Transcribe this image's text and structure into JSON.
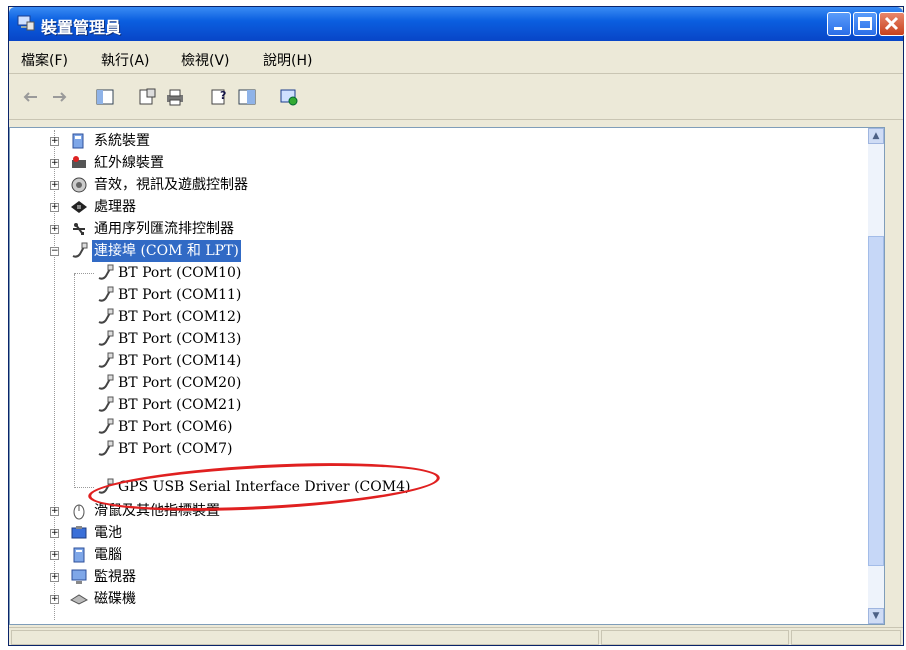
{
  "window": {
    "title": "裝置管理員"
  },
  "menu": {
    "file": "檔案(F)",
    "action": "執行(A)",
    "view": "檢視(V)",
    "help": "說明(H)"
  },
  "toolbar": {
    "icons": [
      "back-arrow-icon",
      "forward-arrow-icon",
      "console-tree-icon",
      "properties-icon",
      "print-icon",
      "help-icon",
      "view-icon",
      "scan-hardware-icon"
    ]
  },
  "tree": {
    "categories": [
      {
        "label": "系統裝置",
        "expanded": false
      },
      {
        "label": "紅外線裝置",
        "expanded": false
      },
      {
        "label": "音效，視訊及遊戲控制器",
        "expanded": false
      },
      {
        "label": "處理器",
        "expanded": false
      },
      {
        "label": "通用序列匯流排控制器",
        "expanded": false
      },
      {
        "label": "連接埠 (COM 和 LPT)",
        "expanded": true,
        "selected": true
      }
    ],
    "ports": [
      "BT Port (COM10)",
      "BT Port (COM11)",
      "BT Port (COM12)",
      "BT Port (COM13)",
      "BT Port (COM14)",
      "BT Port (COM20)",
      "BT Port (COM21)",
      "BT Port (COM6)",
      "BT Port (COM7)",
      "GPS USB Serial Interface Driver (COM4)"
    ],
    "after": [
      {
        "label": "滑鼠及其他指標裝置",
        "expanded": false
      },
      {
        "label": "電池",
        "expanded": false
      },
      {
        "label": "電腦",
        "expanded": false
      },
      {
        "label": "監視器",
        "expanded": false
      },
      {
        "label": "磁碟機",
        "expanded": false
      }
    ]
  },
  "colors": {
    "title_blue": "#0b5fe0",
    "selection": "#316ac5",
    "highlight_circle": "#e02020"
  }
}
